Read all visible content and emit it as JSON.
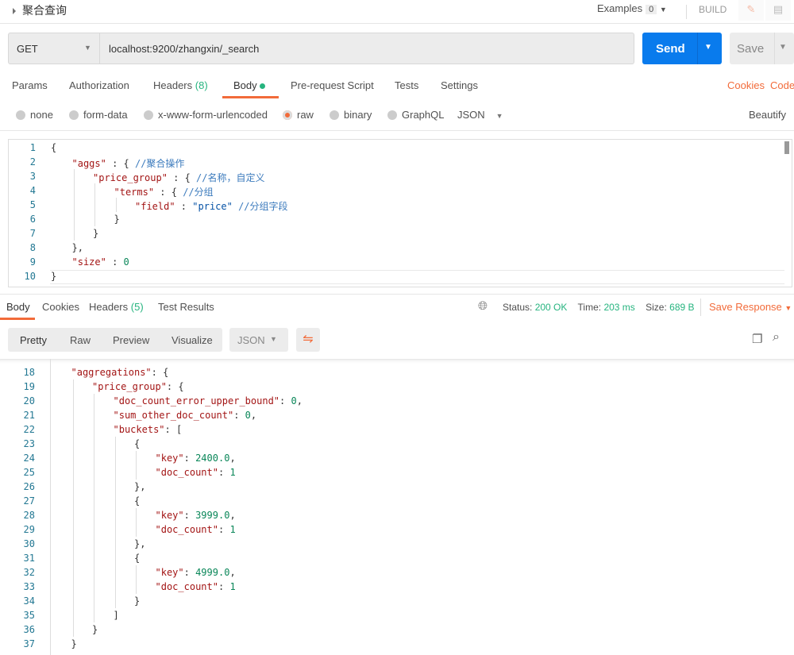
{
  "header": {
    "title": "聚合查询",
    "examples_label": "Examples",
    "examples_count": "0",
    "build_label": "BUILD"
  },
  "request": {
    "method": "GET",
    "url": "localhost:9200/zhangxin/_search",
    "send_label": "Send",
    "save_label": "Save"
  },
  "req_tabs": [
    {
      "label": "Params"
    },
    {
      "label": "Authorization"
    },
    {
      "label": "Headers",
      "count": "(8)"
    },
    {
      "label": "Body"
    },
    {
      "label": "Pre-request Script"
    },
    {
      "label": "Tests"
    },
    {
      "label": "Settings"
    }
  ],
  "req_links": {
    "cookies": "Cookies",
    "code": "Code"
  },
  "body_types": [
    {
      "label": "none"
    },
    {
      "label": "form-data"
    },
    {
      "label": "x-www-form-urlencoded"
    },
    {
      "label": "raw",
      "selected": true
    },
    {
      "label": "binary"
    },
    {
      "label": "GraphQL"
    }
  ],
  "body_format": "JSON",
  "beautify": "Beautify",
  "request_body": [
    {
      "n": "1",
      "i": 0,
      "t": [
        [
          "p",
          "{"
        ]
      ]
    },
    {
      "n": "2",
      "i": 1,
      "t": [
        [
          "k",
          "\"aggs\""
        ],
        [
          "p",
          " : { "
        ],
        [
          "c",
          "//聚合操作"
        ]
      ]
    },
    {
      "n": "3",
      "i": 2,
      "t": [
        [
          "k",
          "\"price_group\""
        ],
        [
          "p",
          " : { "
        ],
        [
          "c",
          "//名称，自定义"
        ]
      ]
    },
    {
      "n": "4",
      "i": 3,
      "t": [
        [
          "k",
          "\"terms\""
        ],
        [
          "p",
          " : { "
        ],
        [
          "c",
          "//分组"
        ]
      ]
    },
    {
      "n": "5",
      "i": 4,
      "t": [
        [
          "k",
          "\"field\""
        ],
        [
          "p",
          " : "
        ],
        [
          "s",
          "\"price\""
        ],
        [
          "c",
          " //分组字段"
        ]
      ]
    },
    {
      "n": "6",
      "i": 3,
      "t": [
        [
          "p",
          "}"
        ]
      ]
    },
    {
      "n": "7",
      "i": 2,
      "t": [
        [
          "p",
          "}"
        ]
      ]
    },
    {
      "n": "8",
      "i": 1,
      "t": [
        [
          "p",
          "},"
        ]
      ]
    },
    {
      "n": "9",
      "i": 1,
      "t": [
        [
          "k",
          "\"size\""
        ],
        [
          "p",
          " : "
        ],
        [
          "n",
          "0"
        ]
      ]
    },
    {
      "n": "10",
      "i": 0,
      "t": [
        [
          "p",
          "}"
        ]
      ]
    }
  ],
  "resp_tabs": [
    {
      "label": "Body"
    },
    {
      "label": "Cookies"
    },
    {
      "label": "Headers",
      "count": "(5)"
    },
    {
      "label": "Test Results"
    }
  ],
  "status": {
    "status_label": "Status:",
    "status": "200 OK",
    "time_label": "Time:",
    "time": "203 ms",
    "size_label": "Size:",
    "size": "689 B",
    "save_response": "Save Response"
  },
  "view_modes": [
    "Pretty",
    "Raw",
    "Preview",
    "Visualize"
  ],
  "resp_format": "JSON",
  "response_body": [
    {
      "n": "18",
      "i": 1,
      "t": [
        [
          "k",
          "\"aggregations\""
        ],
        [
          "p",
          ": {"
        ]
      ]
    },
    {
      "n": "19",
      "i": 2,
      "t": [
        [
          "k",
          "\"price_group\""
        ],
        [
          "p",
          ": {"
        ]
      ]
    },
    {
      "n": "20",
      "i": 3,
      "t": [
        [
          "k",
          "\"doc_count_error_upper_bound\""
        ],
        [
          "p",
          ": "
        ],
        [
          "n",
          "0"
        ],
        [
          "p",
          ","
        ]
      ]
    },
    {
      "n": "21",
      "i": 3,
      "t": [
        [
          "k",
          "\"sum_other_doc_count\""
        ],
        [
          "p",
          ": "
        ],
        [
          "n",
          "0"
        ],
        [
          "p",
          ","
        ]
      ]
    },
    {
      "n": "22",
      "i": 3,
      "t": [
        [
          "k",
          "\"buckets\""
        ],
        [
          "p",
          ": ["
        ]
      ]
    },
    {
      "n": "23",
      "i": 4,
      "t": [
        [
          "p",
          "{"
        ]
      ]
    },
    {
      "n": "24",
      "i": 5,
      "t": [
        [
          "k",
          "\"key\""
        ],
        [
          "p",
          ": "
        ],
        [
          "n",
          "2400.0"
        ],
        [
          "p",
          ","
        ]
      ]
    },
    {
      "n": "25",
      "i": 5,
      "t": [
        [
          "k",
          "\"doc_count\""
        ],
        [
          "p",
          ": "
        ],
        [
          "n",
          "1"
        ]
      ]
    },
    {
      "n": "26",
      "i": 4,
      "t": [
        [
          "p",
          "},"
        ]
      ]
    },
    {
      "n": "27",
      "i": 4,
      "t": [
        [
          "p",
          "{"
        ]
      ]
    },
    {
      "n": "28",
      "i": 5,
      "t": [
        [
          "k",
          "\"key\""
        ],
        [
          "p",
          ": "
        ],
        [
          "n",
          "3999.0"
        ],
        [
          "p",
          ","
        ]
      ]
    },
    {
      "n": "29",
      "i": 5,
      "t": [
        [
          "k",
          "\"doc_count\""
        ],
        [
          "p",
          ": "
        ],
        [
          "n",
          "1"
        ]
      ]
    },
    {
      "n": "30",
      "i": 4,
      "t": [
        [
          "p",
          "},"
        ]
      ]
    },
    {
      "n": "31",
      "i": 4,
      "t": [
        [
          "p",
          "{"
        ]
      ]
    },
    {
      "n": "32",
      "i": 5,
      "t": [
        [
          "k",
          "\"key\""
        ],
        [
          "p",
          ": "
        ],
        [
          "n",
          "4999.0"
        ],
        [
          "p",
          ","
        ]
      ]
    },
    {
      "n": "33",
      "i": 5,
      "t": [
        [
          "k",
          "\"doc_count\""
        ],
        [
          "p",
          ": "
        ],
        [
          "n",
          "1"
        ]
      ]
    },
    {
      "n": "34",
      "i": 4,
      "t": [
        [
          "p",
          "}"
        ]
      ]
    },
    {
      "n": "35",
      "i": 3,
      "t": [
        [
          "p",
          "]"
        ]
      ]
    },
    {
      "n": "36",
      "i": 2,
      "t": [
        [
          "p",
          "}"
        ]
      ]
    },
    {
      "n": "37",
      "i": 1,
      "t": [
        [
          "p",
          "}"
        ]
      ]
    }
  ],
  "colors": {
    "accent": "#f26b3a",
    "send": "#097bed",
    "success": "#26b47f"
  }
}
